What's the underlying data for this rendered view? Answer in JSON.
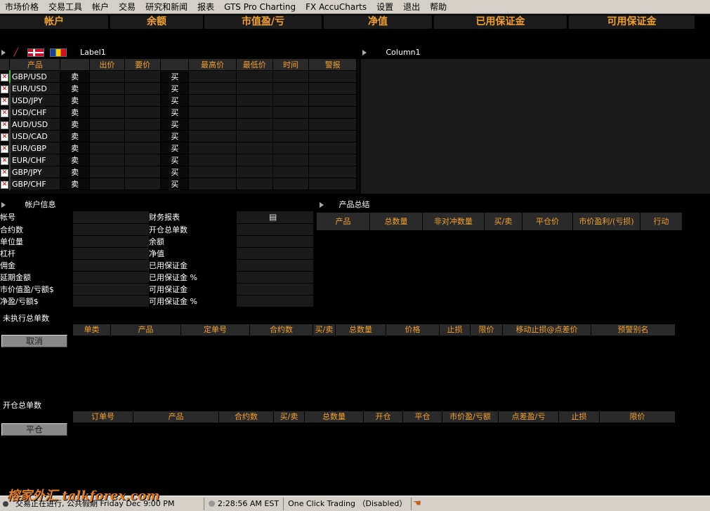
{
  "menu": [
    "市场价格",
    "交易工具",
    "帐户",
    "交易",
    "研究和新闻",
    "报表",
    "GTS Pro Charting",
    "FX AccuCharts",
    "设置",
    "退出",
    "帮助"
  ],
  "summary_headers": [
    "帐户",
    "余额",
    "市值盈/亏",
    "净值",
    "已用保证金",
    "可用保证金"
  ],
  "quotes": {
    "label": "Label1",
    "headers": [
      "产品",
      "出价",
      "要价",
      "最高价",
      "最低价",
      "时间",
      "警报"
    ],
    "sell_label": "卖",
    "buy_label": "买",
    "rows": [
      "GBP/USD",
      "EUR/USD",
      "USD/JPY",
      "USD/CHF",
      "AUD/USD",
      "USD/CAD",
      "EUR/GBP",
      "EUR/CHF",
      "GBP/JPY",
      "GBP/CHF"
    ]
  },
  "right_panel": {
    "title": "Column1"
  },
  "account_info": {
    "title": "帐户信息",
    "left_labels": [
      "帐号",
      "合约数",
      "单位量",
      "杠杆",
      "佣金",
      "延期金额",
      "市价值盈/亏额$",
      "净盈/亏额$"
    ],
    "right_labels": [
      "财务报表",
      "开仓总单数",
      "余额",
      "净值",
      "已用保证金",
      "已用保证金 %",
      "可用保证金",
      "可用保证金 %"
    ]
  },
  "product_summary": {
    "title": "产品总结",
    "headers": [
      "产品",
      "总数量",
      "非对冲数量",
      "买/卖",
      "平仓价",
      "市价盈利/(亏损)",
      "行动"
    ]
  },
  "pending_orders": {
    "title": "未执行总单数",
    "headers": [
      "单类",
      "产品",
      "定单号",
      "合约数",
      "买/卖",
      "总数量",
      "价格",
      "止损",
      "限价",
      "移动止损@点差价",
      "预警别名"
    ],
    "button": "取消"
  },
  "open_positions": {
    "title": "开仓总单数",
    "headers": [
      "订单号",
      "产品",
      "合约数",
      "买/卖",
      "总数量",
      "开仓",
      "平仓",
      "市价盈/亏额",
      "点差盈/亏",
      "止损",
      "限价"
    ],
    "button": "平仓"
  },
  "status": {
    "connection": "交易正在进行, 公共假期 Friday Dec 9:00 PM",
    "time": "2:28:56 AM EST",
    "one_click": "One Click Trading （Disabled）"
  },
  "watermark": "榕家外汇 talkforex.com",
  "colors": {
    "header_text": "#f0a030",
    "background": "#000000"
  }
}
